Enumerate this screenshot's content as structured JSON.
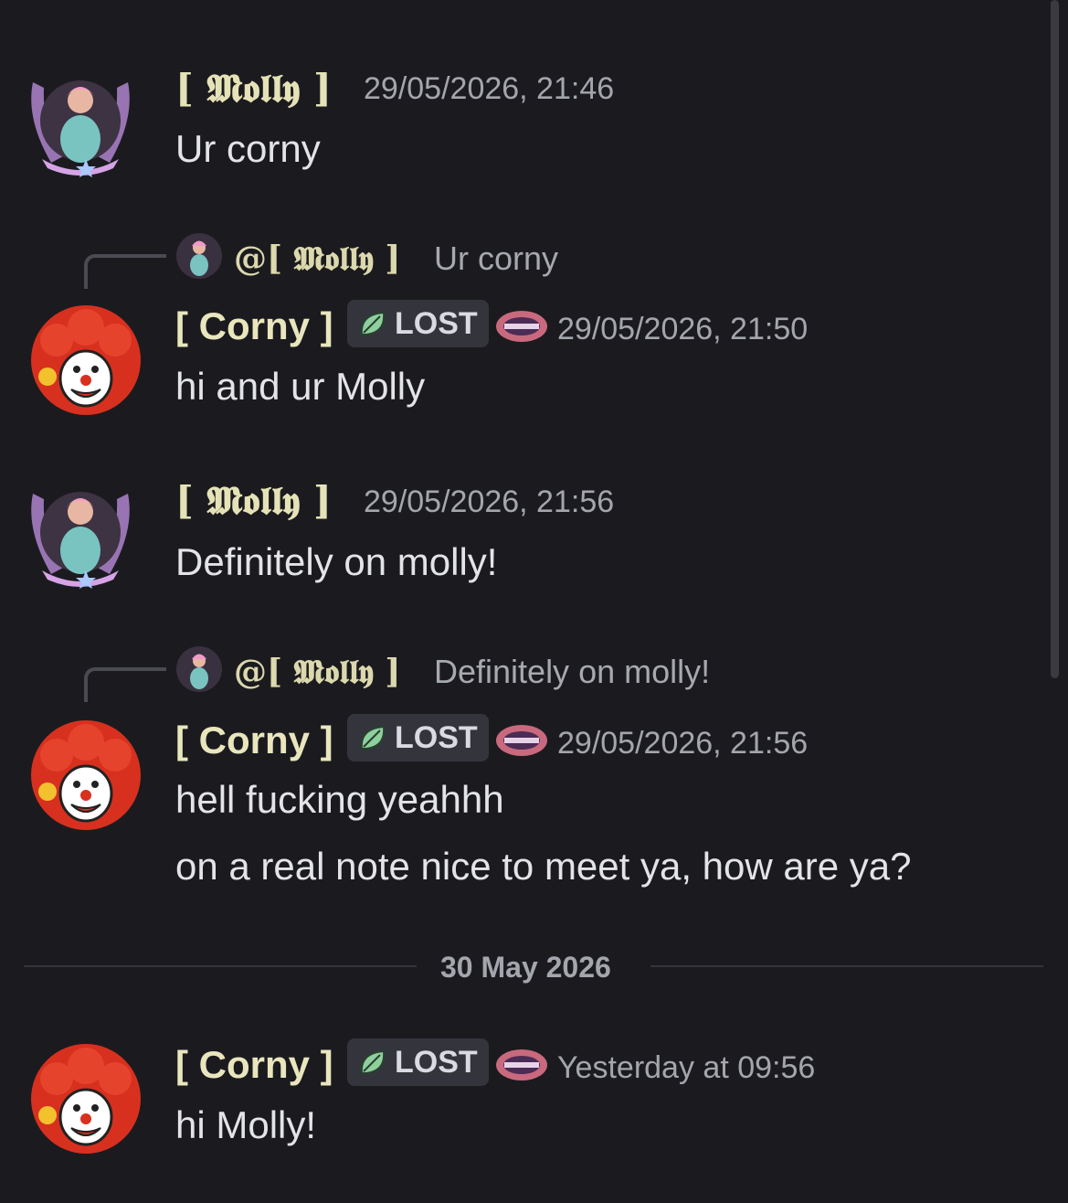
{
  "users": {
    "molly": {
      "display_name": "[ 𝕸𝖔𝖑𝖑𝖞 ]",
      "mention": "@[ 𝕸𝖔𝖑𝖑𝖞 ]"
    },
    "corny": {
      "display_name": "[ Corny ]",
      "tag": "LOST",
      "emblem_icon": "guild-emblem-icon"
    }
  },
  "messages": [
    {
      "author": "molly",
      "timestamp": "29/05/2026, 21:46",
      "lines": [
        "Ur corny"
      ]
    },
    {
      "author": "corny",
      "reply": {
        "mention": "@[ 𝕸𝖔𝖑𝖑𝖞 ]",
        "text": "Ur corny"
      },
      "timestamp": "29/05/2026, 21:50",
      "lines": [
        "hi and ur Molly"
      ]
    },
    {
      "author": "molly",
      "timestamp": "29/05/2026, 21:56",
      "lines": [
        "Definitely on molly!"
      ]
    },
    {
      "author": "corny",
      "reply": {
        "mention": "@[ 𝕸𝖔𝖑𝖑𝖞 ]",
        "text": "Definitely on molly!"
      },
      "timestamp": "29/05/2026, 21:56",
      "lines": [
        "hell fucking yeahhh",
        "on a real note nice to meet ya, how are ya?"
      ]
    },
    {
      "author": "corny",
      "timestamp": "Yesterday at 09:56",
      "lines": [
        "hi Molly!"
      ]
    }
  ],
  "divider": {
    "label": "30 May 2026"
  },
  "colors": {
    "background": "#1b1b1f",
    "username": "#e6e2b8",
    "timestamp": "#a4a6ad",
    "message": "#e3e4e8",
    "tag_bg": "#34353c",
    "leaf_green": "#8fcf9e"
  },
  "icons": {
    "molly_avatar": "molly-avatar-icon",
    "corny_avatar": "clown-avatar-icon",
    "tag_leaf": "leaf-icon"
  }
}
